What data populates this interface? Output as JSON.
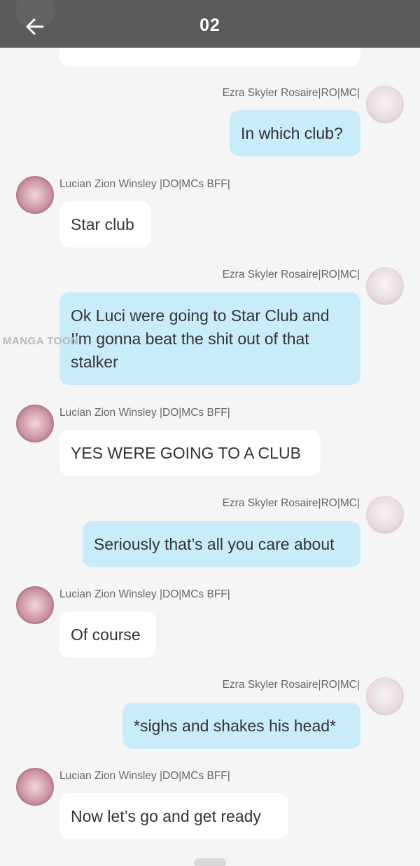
{
  "header": {
    "title": "02"
  },
  "senders": {
    "ezra": "Ezra Skyler Rosaire|RO|MC|",
    "lucian": "Lucian Zion Winsley |DO|MCs BFF|"
  },
  "watermark": "MANGA TOON",
  "messages": [
    {
      "from": "ezra",
      "text": "In which club?"
    },
    {
      "from": "lucian",
      "text": "Star club"
    },
    {
      "from": "ezra",
      "text": "Ok Luci were going to Star Club and I'm gonna beat the shit out of that stalker"
    },
    {
      "from": "lucian",
      "text": "YES WERE GOING TO A CLUB"
    },
    {
      "from": "ezra",
      "text": "Seriously that’s all you care about"
    },
    {
      "from": "lucian",
      "text": "Of course"
    },
    {
      "from": "ezra",
      "text": "*sighs and shakes his head*"
    },
    {
      "from": "lucian",
      "text": "Now let’s go and get ready"
    }
  ],
  "colors": {
    "header_bg": "#5b5b5b",
    "my_bubble": "#c9ecfa",
    "their_bubble": "#ffffff",
    "page_bg": "#f5f5f5"
  }
}
